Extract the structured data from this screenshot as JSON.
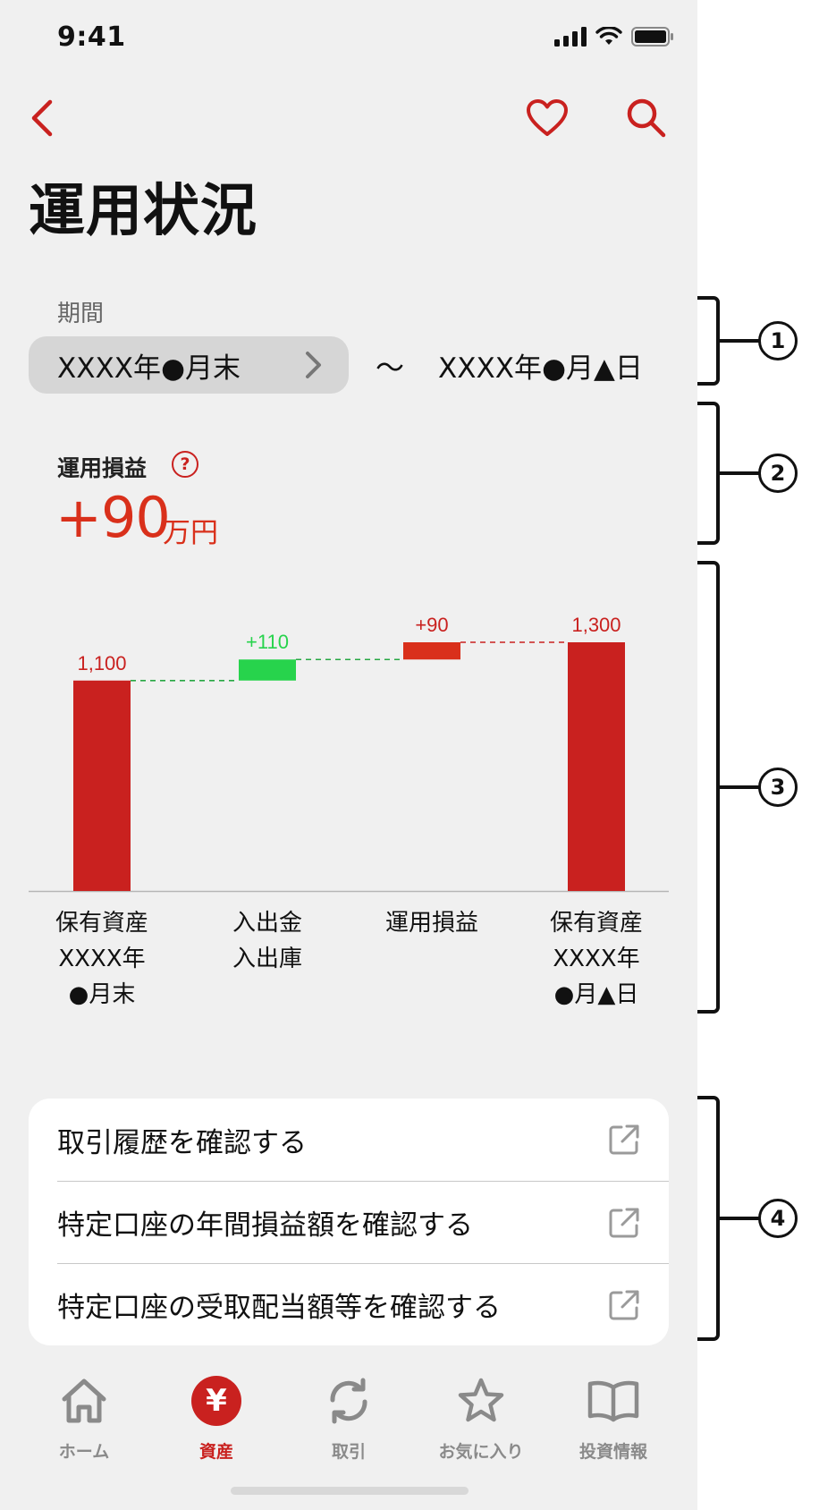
{
  "status_bar": {
    "time": "9:41"
  },
  "header": {
    "title": "運用状況"
  },
  "period": {
    "label": "期間",
    "start": "XXXX年●月末",
    "separator": "〜",
    "end": "XXXX年●月▲日"
  },
  "profit": {
    "label": "運用損益",
    "help": "?",
    "value": "+90",
    "unit": "万円"
  },
  "chart_data": {
    "type": "bar",
    "subtype": "waterfall",
    "categories": [
      [
        "保有資産",
        "XXXX年",
        "●月末"
      ],
      [
        "入出金",
        "入出庫"
      ],
      [
        "運用損益"
      ],
      [
        "保有資産",
        "XXXX年",
        "●月▲日"
      ]
    ],
    "values": [
      1100,
      110,
      90,
      1300
    ],
    "data_labels": [
      "1,100",
      "+110",
      "+90",
      "1,300"
    ],
    "colors": [
      "#c9211f",
      "#27d34c",
      "#d9301b",
      "#c9211f"
    ],
    "label_colors": [
      "#c9211f",
      "#27d34c",
      "#c9211f",
      "#c9211f"
    ],
    "ylim": [
      0,
      1300
    ],
    "grid": false
  },
  "links": [
    {
      "label": "取引履歴を確認する"
    },
    {
      "label": "特定口座の年間損益額を確認する"
    },
    {
      "label": "特定口座の受取配当額等を確認する"
    }
  ],
  "tabs": [
    {
      "label": "ホーム",
      "icon": "home-icon",
      "active": false
    },
    {
      "label": "資産",
      "icon": "yen-icon",
      "active": true,
      "glyph": "¥"
    },
    {
      "label": "取引",
      "icon": "refresh-icon",
      "active": false
    },
    {
      "label": "お気に入り",
      "icon": "star-icon",
      "active": false
    },
    {
      "label": "投資情報",
      "icon": "book-icon",
      "active": false
    }
  ],
  "annotations": [
    "1",
    "2",
    "3",
    "4"
  ],
  "colors": {
    "accent": "#c9211f",
    "gain": "#27d34c",
    "profit": "#d9301b",
    "background": "#f0f0f0"
  }
}
